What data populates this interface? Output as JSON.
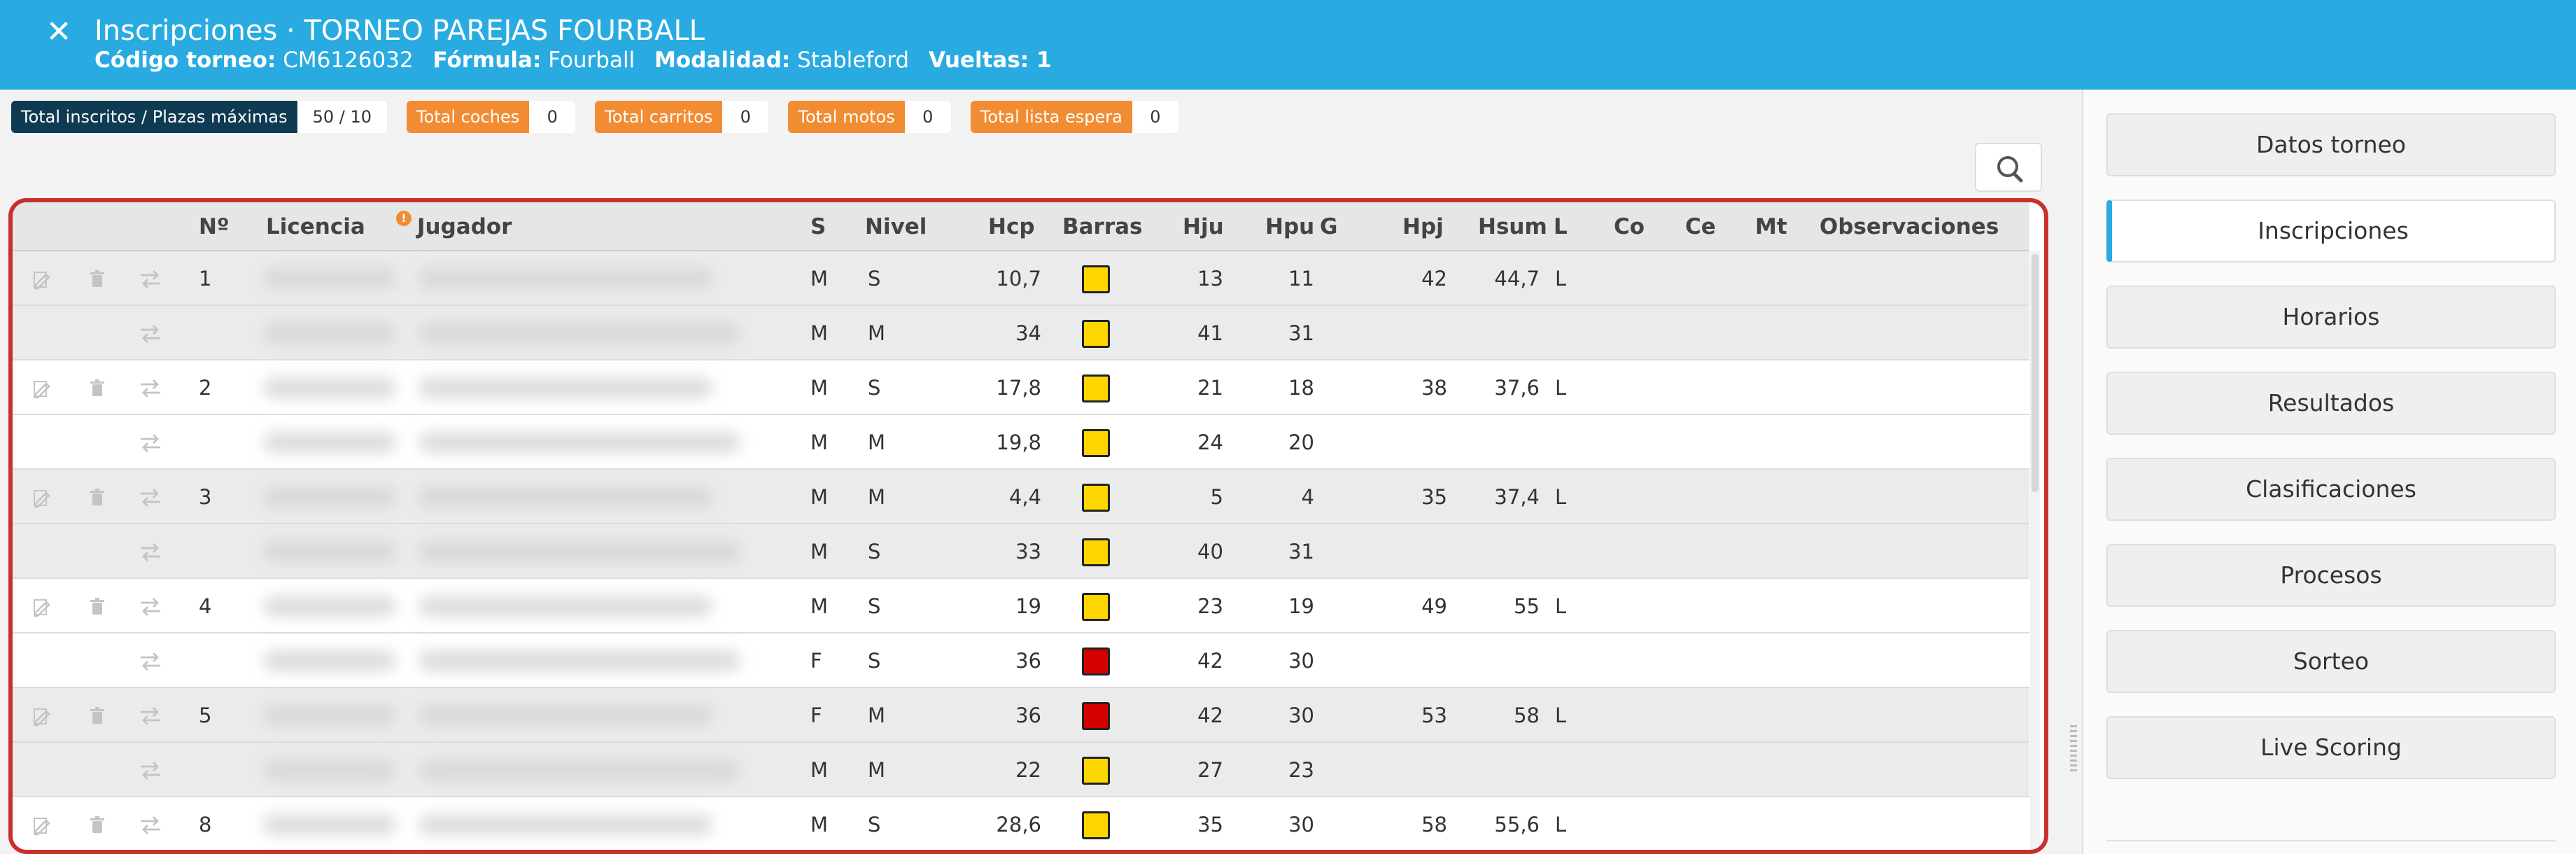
{
  "header": {
    "title": "Inscripciones · TORNEO PAREJAS FOURBALL",
    "codigo_label": "Código torneo:",
    "codigo_value": "CM6126032",
    "formula_label": "Fórmula:",
    "formula_value": "Fourball",
    "modalidad_label": "Modalidad:",
    "modalidad_value": "Stableford",
    "vueltas_label": "Vueltas: 1",
    "close_icon": "close-icon"
  },
  "counters": [
    {
      "label": "Total inscritos / Plazas máximas",
      "value": "50 / 10",
      "color": "#0e3a52"
    },
    {
      "label": "Total coches",
      "value": "0",
      "color": "#f28c33"
    },
    {
      "label": "Total carritos",
      "value": "0",
      "color": "#f28c33"
    },
    {
      "label": "Total motos",
      "value": "0",
      "color": "#f28c33"
    },
    {
      "label": "Total lista espera",
      "value": "0",
      "color": "#f28c33"
    }
  ],
  "table": {
    "columns": {
      "n": "Nº",
      "licencia": "Licencia",
      "jugador": "Jugador",
      "s": "S",
      "nivel": "Nivel",
      "hcp": "Hcp",
      "barras": "Barras",
      "hju": "Hju",
      "hpu": "Hpu",
      "g": "G",
      "hpj": "Hpj",
      "hsum": "Hsum",
      "l": "L",
      "co": "Co",
      "ce": "Ce",
      "mt": "Mt",
      "obs": "Observaciones"
    },
    "rows": [
      {
        "n": "1",
        "s": "M",
        "nivel": "S",
        "hcp": "10,7",
        "barras": "yellow",
        "hju": "13",
        "hpu": "11",
        "hpj": "42",
        "hsum": "44,7",
        "l": "L"
      },
      {
        "n": "",
        "s": "M",
        "nivel": "M",
        "hcp": "34",
        "barras": "yellow",
        "hju": "41",
        "hpu": "31",
        "hpj": "",
        "hsum": "",
        "l": ""
      },
      {
        "n": "2",
        "s": "M",
        "nivel": "S",
        "hcp": "17,8",
        "barras": "yellow",
        "hju": "21",
        "hpu": "18",
        "hpj": "38",
        "hsum": "37,6",
        "l": "L"
      },
      {
        "n": "",
        "s": "M",
        "nivel": "M",
        "hcp": "19,8",
        "barras": "yellow",
        "hju": "24",
        "hpu": "20",
        "hpj": "",
        "hsum": "",
        "l": ""
      },
      {
        "n": "3",
        "s": "M",
        "nivel": "M",
        "hcp": "4,4",
        "barras": "yellow",
        "hju": "5",
        "hpu": "4",
        "hpj": "35",
        "hsum": "37,4",
        "l": "L"
      },
      {
        "n": "",
        "s": "M",
        "nivel": "S",
        "hcp": "33",
        "barras": "yellow",
        "hju": "40",
        "hpu": "31",
        "hpj": "",
        "hsum": "",
        "l": ""
      },
      {
        "n": "4",
        "s": "M",
        "nivel": "S",
        "hcp": "19",
        "barras": "yellow",
        "hju": "23",
        "hpu": "19",
        "hpj": "49",
        "hsum": "55",
        "l": "L"
      },
      {
        "n": "",
        "s": "F",
        "nivel": "S",
        "hcp": "36",
        "barras": "red",
        "hju": "42",
        "hpu": "30",
        "hpj": "",
        "hsum": "",
        "l": ""
      },
      {
        "n": "5",
        "s": "F",
        "nivel": "M",
        "hcp": "36",
        "barras": "red",
        "hju": "42",
        "hpu": "30",
        "hpj": "53",
        "hsum": "58",
        "l": "L"
      },
      {
        "n": "",
        "s": "M",
        "nivel": "M",
        "hcp": "22",
        "barras": "yellow",
        "hju": "27",
        "hpu": "23",
        "hpj": "",
        "hsum": "",
        "l": ""
      },
      {
        "n": "8",
        "s": "M",
        "nivel": "S",
        "hcp": "28,6",
        "barras": "yellow",
        "hju": "35",
        "hpu": "30",
        "hpj": "58",
        "hsum": "55,6",
        "l": "L"
      }
    ],
    "barras_colors": {
      "yellow": "#ffd700",
      "red": "#d40000"
    }
  },
  "sidebar": {
    "items": [
      {
        "label": "Datos torneo",
        "active": false
      },
      {
        "label": "Inscripciones",
        "active": true
      },
      {
        "label": "Horarios",
        "active": false
      },
      {
        "label": "Resultados",
        "active": false
      },
      {
        "label": "Clasificaciones",
        "active": false
      },
      {
        "label": "Procesos",
        "active": false
      },
      {
        "label": "Sorteo",
        "active": false
      },
      {
        "label": "Live Scoring",
        "active": false
      }
    ]
  },
  "icons": {
    "edit": "edit-icon",
    "delete": "trash-icon",
    "swap": "swap-icon",
    "search": "search-icon",
    "info": "info-icon"
  }
}
